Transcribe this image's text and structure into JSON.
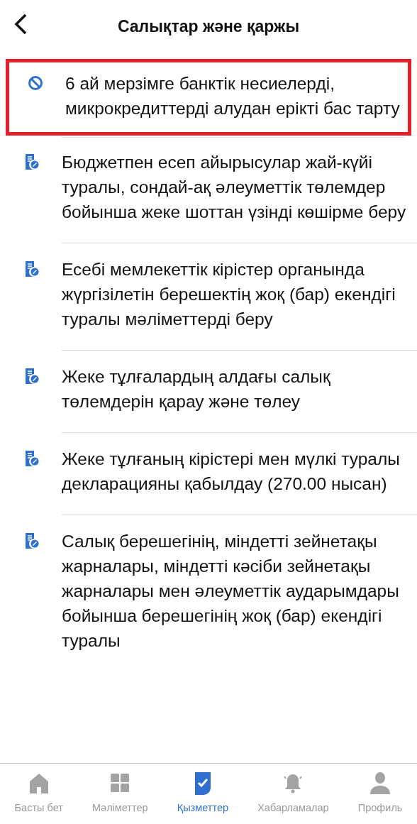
{
  "header": {
    "title": "Салықтар және қаржы"
  },
  "services": [
    {
      "kind": "blocked",
      "highlighted": true,
      "title": "6 ай мерзімге банктік несиелерді, микрокредиттерді алудан ерікті бас тарту"
    },
    {
      "kind": "document",
      "highlighted": false,
      "title": "Бюджетпен есеп айырысулар жай-күйі туралы, сондай-ақ әлеуметтік төлемдер бойынша жеке шоттан үзінді көшірме беру"
    },
    {
      "kind": "document",
      "highlighted": false,
      "title": "Есебі мемлекеттік кірістер органында жүргізілетін берешектің жоқ (бар) екендігі туралы мәліметтерді беру"
    },
    {
      "kind": "document",
      "highlighted": false,
      "title": "Жеке тұлғалардың алдағы салық төлемдерін қарау және төлеу"
    },
    {
      "kind": "document",
      "highlighted": false,
      "title": "Жеке тұлғаның кірістері мен мүлкі туралы декларацияны қабылдау (270.00 нысан)"
    },
    {
      "kind": "document",
      "highlighted": false,
      "title": "Салық берешегінің, міндетті зейнетақы жарналары, міндетті кәсіби зейнетақы жарналары мен әлеуметтік аударымдары бойынша берешегінің жоқ (бар) екендігі туралы"
    }
  ],
  "tab_bar": [
    {
      "kind": "home",
      "label": "Басты бет",
      "selected": false
    },
    {
      "kind": "grid",
      "label": "Мәліметтер",
      "selected": false
    },
    {
      "kind": "services",
      "label": "Қызметтер",
      "selected": true
    },
    {
      "kind": "bell",
      "label": "Хабарламалар",
      "selected": false
    },
    {
      "kind": "profile",
      "label": "Профиль",
      "selected": false
    }
  ]
}
